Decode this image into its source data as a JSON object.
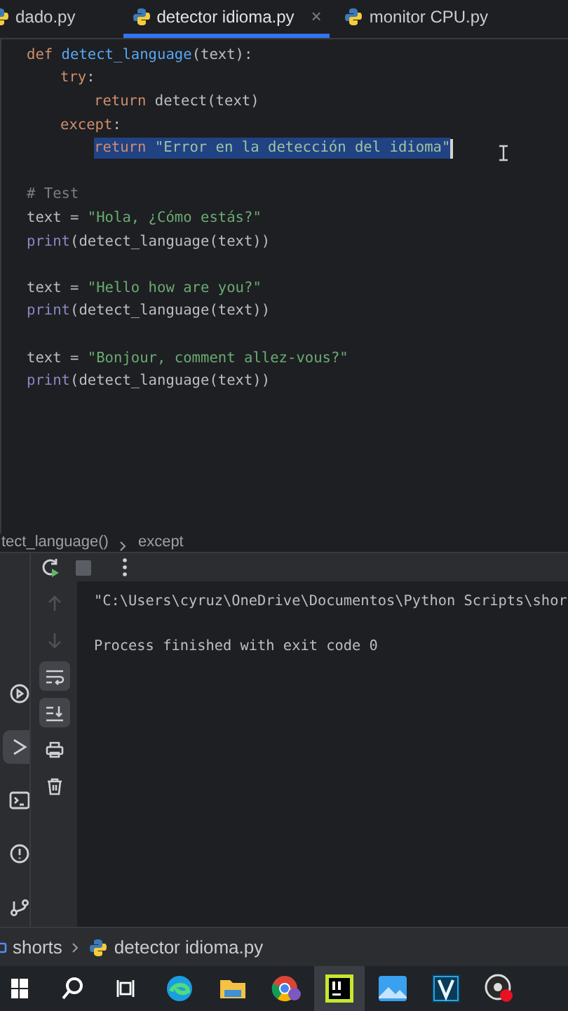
{
  "tabs": [
    {
      "label": "dado.py",
      "selected": false
    },
    {
      "label": "detector idioma.py",
      "selected": true,
      "close": "×"
    },
    {
      "label": "monitor CPU.py",
      "selected": false
    }
  ],
  "code": [
    {
      "kind": "code",
      "selected": false,
      "tokens": [
        {
          "kind": "keyword",
          "text": "def"
        },
        {
          "kind": "function",
          "text": " detect_language"
        },
        {
          "kind": "plain",
          "text": "(text):"
        }
      ],
      "children": [
        {
          "kind": "code",
          "selected": false,
          "tokens": [
            {
              "kind": "keyword",
              "text": "try"
            },
            {
              "kind": "plain",
              "text": ":"
            }
          ],
          "children": [
            {
              "kind": "code",
              "selected": false,
              "tokens": [
                {
                  "kind": "keyword",
                  "text": "return"
                },
                {
                  "kind": "plain",
                  "text": " detect(text)"
                }
              ]
            }
          ]
        },
        {
          "kind": "code",
          "selected": false,
          "tokens": [
            {
              "kind": "keyword",
              "text": "except"
            },
            {
              "kind": "plain",
              "text": ":"
            }
          ],
          "children": [
            {
              "kind": "code",
              "selected": true,
              "tokens": [
                {
                  "kind": "keyword",
                  "text": "return"
                },
                {
                  "kind": "string",
                  "text": " \"Error en la detección del idioma\""
                }
              ]
            }
          ]
        }
      ]
    },
    {
      "kind": "blank",
      "selected": false
    },
    {
      "kind": "code",
      "selected": false,
      "tokens": [
        {
          "kind": "comment",
          "text": "# Test"
        }
      ]
    },
    {
      "kind": "code",
      "selected": false,
      "tokens": [
        {
          "kind": "plain",
          "text": "text = "
        },
        {
          "kind": "string",
          "text": "\"Hola, ¿Cómo estás?\""
        }
      ]
    },
    {
      "kind": "code",
      "selected": false,
      "tokens": [
        {
          "kind": "builtin",
          "text": "print"
        },
        {
          "kind": "plain",
          "text": "(detect_language(text))"
        }
      ]
    },
    {
      "kind": "blank",
      "selected": false
    },
    {
      "kind": "code",
      "selected": false,
      "tokens": [
        {
          "kind": "plain",
          "text": "text = "
        },
        {
          "kind": "string",
          "text": "\"Hello how are you?\""
        }
      ]
    },
    {
      "kind": "code",
      "selected": false,
      "tokens": [
        {
          "kind": "builtin",
          "text": "print"
        },
        {
          "kind": "plain",
          "text": "(detect_language(text))"
        }
      ]
    },
    {
      "kind": "blank",
      "selected": false
    },
    {
      "kind": "code",
      "selected": false,
      "tokens": [
        {
          "kind": "plain",
          "text": "text = "
        },
        {
          "kind": "string",
          "text": "\"Bonjour, comment allez-vous?\""
        }
      ]
    },
    {
      "kind": "code",
      "selected": false,
      "tokens": [
        {
          "kind": "builtin",
          "text": "print"
        },
        {
          "kind": "plain",
          "text": "(detect_language(text))"
        }
      ]
    }
  ],
  "editor_breadcrumb": [
    "tect_language()",
    "except"
  ],
  "stripe": [
    {
      "kind": "services",
      "selected": false
    },
    {
      "kind": "run",
      "selected": true
    },
    {
      "kind": "terminal",
      "selected": false
    },
    {
      "kind": "problems",
      "selected": false
    },
    {
      "kind": "git",
      "selected": false
    }
  ],
  "run_tools": [
    {
      "kind": "up",
      "selected": false,
      "disabled": true
    },
    {
      "kind": "down",
      "selected": false,
      "disabled": true
    },
    {
      "kind": "wrap",
      "selected": true,
      "disabled": false
    },
    {
      "kind": "scroll-end",
      "selected": true,
      "disabled": false
    },
    {
      "kind": "print",
      "selected": false,
      "disabled": false
    },
    {
      "kind": "delete",
      "selected": false,
      "disabled": false
    }
  ],
  "output": [
    {
      "kind": "command",
      "text": "\"C:\\Users\\cyruz\\OneDrive\\Documentos\\Python Scripts\\shor"
    },
    {
      "kind": "status",
      "text": "Process finished with exit code 0"
    }
  ],
  "status_breadcrumb": [
    {
      "kind": "folder",
      "text": "shorts"
    },
    {
      "kind": "file",
      "text": "detector idioma.py"
    }
  ],
  "taskbar": [
    {
      "kind": "start",
      "active": false
    },
    {
      "kind": "search",
      "active": false
    },
    {
      "kind": "taskview",
      "active": false
    },
    {
      "kind": "edge",
      "active": false
    },
    {
      "kind": "explorer",
      "active": false
    },
    {
      "kind": "chrome",
      "active": false
    },
    {
      "kind": "pycharm",
      "active": true
    },
    {
      "kind": "photos",
      "active": false
    },
    {
      "kind": "vegas",
      "active": false
    },
    {
      "kind": "recorder",
      "active": false
    }
  ]
}
